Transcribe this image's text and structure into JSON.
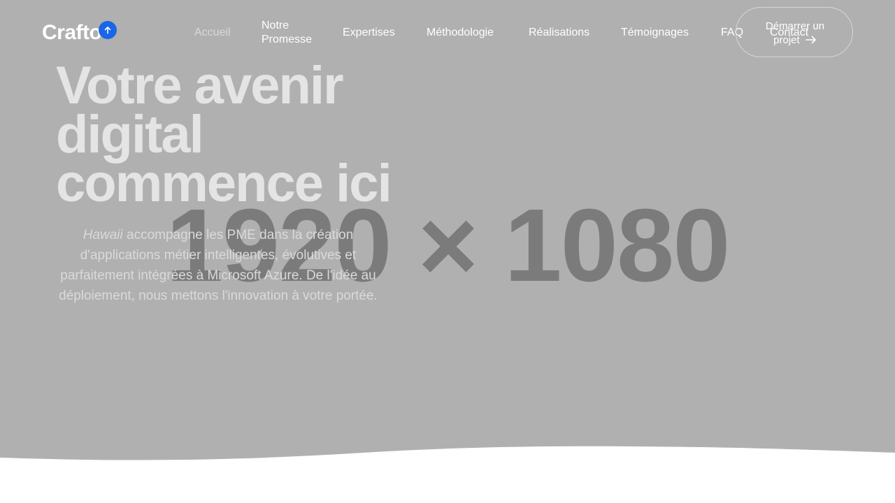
{
  "header": {
    "logo": "Crafto",
    "nav": [
      {
        "label": "Accueil",
        "active": true
      },
      {
        "label": "Notre Promesse"
      },
      {
        "label": "Expertises"
      },
      {
        "label": "Méthodologie"
      },
      {
        "label": "Réalisations"
      },
      {
        "label": "Témoignages"
      },
      {
        "label": "FAQ"
      },
      {
        "label": "Contact"
      }
    ],
    "cta_line1": "Démarrer un",
    "cta_line2": "projet",
    "cta_icon": "arrow-right-icon",
    "scroll_icon": "arrow-up-icon"
  },
  "hero": {
    "placeholder": "1920 × 1080",
    "headline": "Votre avenir digital commence ici",
    "brand": "Hawaii",
    "lead": " accompagne les PME dans la création d'applications métier intelligentes, évolutives et parfaitement intégrées à Microsoft Azure. De l'idée au déploiement, nous mettons l'innovation à votre portée."
  },
  "colors": {
    "hero_bg": "#b0b0b0",
    "accent": "#1a66e8",
    "placeholder": "#7b7b7b"
  }
}
